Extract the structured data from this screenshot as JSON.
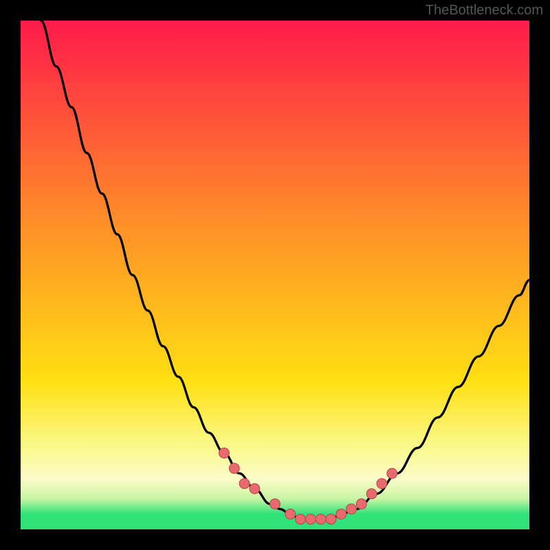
{
  "watermark": "TheBottleneck.com",
  "colors": {
    "top": "#ff1a4a",
    "mid_upper": "#ff8a2a",
    "mid_lower": "#ffe012",
    "pale_yellow": "#faf98e",
    "green": "#2fe27a",
    "curve_stroke": "#000000",
    "marker_fill": "#e86a6f",
    "marker_stroke": "#b94a4a",
    "frame": "#000000"
  },
  "chart_data": {
    "type": "line",
    "title": "",
    "xlabel": "",
    "ylabel": "",
    "xlim": [
      0,
      100
    ],
    "ylim": [
      0,
      100
    ],
    "series": [
      {
        "name": "curve",
        "x": [
          4,
          7,
          10,
          13,
          16,
          19,
          22,
          25,
          28,
          31,
          34,
          37,
          40,
          43,
          46,
          49,
          51,
          53,
          55,
          57,
          59,
          61,
          63,
          66,
          70,
          74,
          78,
          82,
          86,
          90,
          94,
          98,
          100
        ],
        "y": [
          100,
          91,
          83,
          74,
          66,
          58,
          50,
          43,
          36,
          30,
          24,
          19,
          15,
          11,
          8,
          5,
          4,
          3,
          2,
          2,
          2,
          2,
          3,
          4,
          7,
          11,
          16,
          22,
          28,
          34,
          40,
          46,
          49
        ]
      }
    ],
    "markers": {
      "name": "highlight-points",
      "x": [
        40,
        42,
        44,
        46,
        50,
        53,
        55,
        57,
        59,
        61,
        63,
        65,
        67,
        69,
        71,
        73
      ],
      "y": [
        15,
        12,
        9,
        8,
        5,
        3,
        2,
        2,
        2,
        2,
        3,
        4,
        5,
        7,
        9,
        11
      ]
    },
    "gradient_stops": [
      {
        "pos": 0.0,
        "color": "#ff1a4a"
      },
      {
        "pos": 0.38,
        "color": "#ff8a2a"
      },
      {
        "pos": 0.71,
        "color": "#ffe012"
      },
      {
        "pos": 0.84,
        "color": "#faf98e"
      },
      {
        "pos": 0.9,
        "color": "#fcfcc8"
      },
      {
        "pos": 0.94,
        "color": "#c8f5a4"
      },
      {
        "pos": 0.97,
        "color": "#2fe27a"
      },
      {
        "pos": 1.0,
        "color": "#2fe27a"
      }
    ]
  }
}
